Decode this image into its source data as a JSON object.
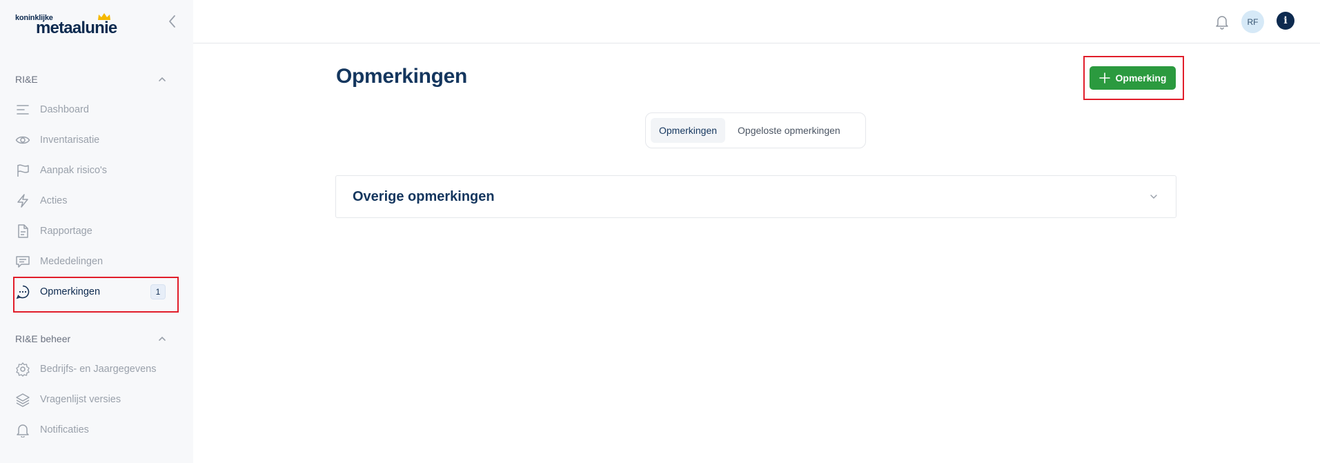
{
  "brand": {
    "small": "koninklijke",
    "big": "metaalunie"
  },
  "sidebar": {
    "sections": [
      {
        "label": "RI&E"
      },
      {
        "label": "RI&E beheer"
      }
    ],
    "items": [
      {
        "label": "Dashboard",
        "icon": "dashboard-icon"
      },
      {
        "label": "Inventarisatie",
        "icon": "eye-icon"
      },
      {
        "label": "Aanpak risico's",
        "icon": "flag-icon"
      },
      {
        "label": "Acties",
        "icon": "lightning-icon"
      },
      {
        "label": "Rapportage",
        "icon": "document-icon"
      },
      {
        "label": "Mededelingen",
        "icon": "message-icon"
      },
      {
        "label": "Opmerkingen",
        "icon": "comment-icon",
        "badge": "1",
        "active": true
      },
      {
        "label": "Bedrijfs- en Jaargegevens",
        "icon": "gear-icon"
      },
      {
        "label": "Vragenlijst versies",
        "icon": "layers-icon"
      },
      {
        "label": "Notificaties",
        "icon": "bell-icon"
      }
    ]
  },
  "topbar": {
    "avatar_initials": "RF",
    "info_label": "i"
  },
  "main": {
    "title": "Opmerkingen",
    "add_button_label": "Opmerking",
    "tabs": [
      {
        "label": "Opmerkingen",
        "active": true
      },
      {
        "label": "Opgeloste opmerkingen",
        "active": false
      }
    ],
    "accordion_title": "Overige opmerkingen"
  },
  "colors": {
    "brand_navy": "#0d2a4f",
    "primary_green": "#2b9a3f",
    "highlight_red": "#e11d2a",
    "sidebar_bg": "#f7f8fa"
  }
}
